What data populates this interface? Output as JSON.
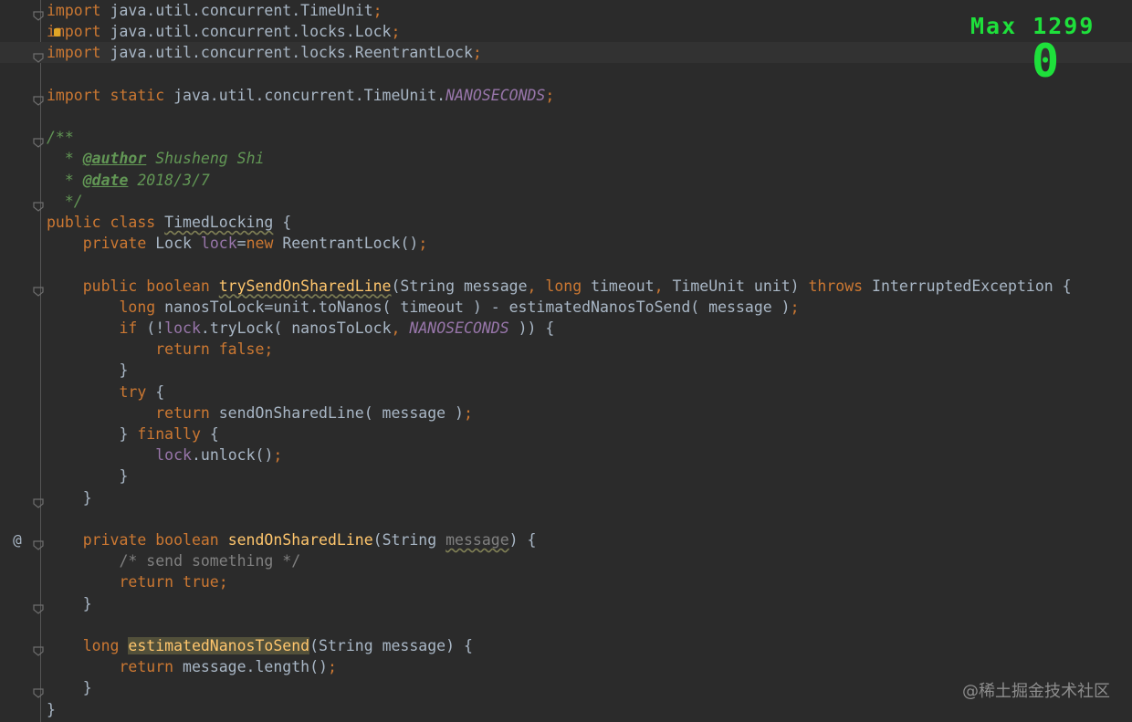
{
  "editor": {
    "lines": [
      {
        "segments": [
          {
            "t": "import",
            "c": "k"
          },
          {
            "t": " java.util.concurrent.TimeUnit",
            "c": "p"
          },
          {
            "t": ";",
            "c": "k"
          }
        ]
      },
      {
        "segments": [
          {
            "t": "import",
            "c": "k"
          },
          {
            "t": " java.util.concurrent.locks.Lock",
            "c": "p"
          },
          {
            "t": ";",
            "c": "k"
          }
        ]
      },
      {
        "segments": [
          {
            "t": "import",
            "c": "k"
          },
          {
            "t": " java.util.concurrent.locks.ReentrantLock",
            "c": "p"
          },
          {
            "t": ";",
            "c": "k"
          }
        ]
      },
      {
        "segments": []
      },
      {
        "segments": [
          {
            "t": "import static",
            "c": "k"
          },
          {
            "t": " java.util.concurrent.TimeUnit.",
            "c": "p"
          },
          {
            "t": "NANOSECONDS",
            "c": "fi"
          },
          {
            "t": ";",
            "c": "k"
          }
        ]
      },
      {
        "segments": []
      },
      {
        "segments": [
          {
            "t": "/**",
            "c": "d"
          }
        ]
      },
      {
        "segments": [
          {
            "t": "  * ",
            "c": "d"
          },
          {
            "t": "@author",
            "c": "dt"
          },
          {
            "t": " Shusheng Shi",
            "c": "d"
          }
        ]
      },
      {
        "segments": [
          {
            "t": "  * ",
            "c": "d"
          },
          {
            "t": "@date",
            "c": "dt"
          },
          {
            "t": " 2018/3/7",
            "c": "d"
          }
        ]
      },
      {
        "segments": [
          {
            "t": "  */",
            "c": "d"
          }
        ]
      },
      {
        "segments": [
          {
            "t": "public class ",
            "c": "k"
          },
          {
            "t": "TimedLocking",
            "c": "p warn"
          },
          {
            "t": " {",
            "c": "p"
          }
        ]
      },
      {
        "segments": [
          {
            "t": "    private ",
            "c": "k"
          },
          {
            "t": "Lock ",
            "c": "p"
          },
          {
            "t": "lock",
            "c": "f"
          },
          {
            "t": "=",
            "c": "p"
          },
          {
            "t": "new ",
            "c": "k"
          },
          {
            "t": "ReentrantLock()",
            "c": "p"
          },
          {
            "t": ";",
            "c": "k"
          }
        ]
      },
      {
        "segments": []
      },
      {
        "segments": [
          {
            "t": "    public boolean ",
            "c": "k"
          },
          {
            "t": "trySendOnSharedLine",
            "c": "m warn"
          },
          {
            "t": "(String message",
            "c": "p"
          },
          {
            "t": ", ",
            "c": "k"
          },
          {
            "t": "long ",
            "c": "k"
          },
          {
            "t": "timeout",
            "c": "p"
          },
          {
            "t": ", ",
            "c": "k"
          },
          {
            "t": "TimeUnit unit) ",
            "c": "p"
          },
          {
            "t": "throws ",
            "c": "k"
          },
          {
            "t": "InterruptedException {",
            "c": "p"
          }
        ]
      },
      {
        "segments": [
          {
            "t": "        long ",
            "c": "k"
          },
          {
            "t": "nanosToLock=unit.toNanos( timeout ) - estimatedNanosToSend( message )",
            "c": "p"
          },
          {
            "t": ";",
            "c": "k"
          }
        ]
      },
      {
        "segments": [
          {
            "t": "        if ",
            "c": "k"
          },
          {
            "t": "(!",
            "c": "p"
          },
          {
            "t": "lock",
            "c": "f"
          },
          {
            "t": ".tryLock( nanosToLock",
            "c": "p"
          },
          {
            "t": ", ",
            "c": "k"
          },
          {
            "t": "NANOSECONDS",
            "c": "fi"
          },
          {
            "t": " )) {",
            "c": "p"
          }
        ]
      },
      {
        "segments": [
          {
            "t": "            return false",
            "c": "k"
          },
          {
            "t": ";",
            "c": "k"
          }
        ]
      },
      {
        "segments": [
          {
            "t": "        }",
            "c": "p"
          }
        ]
      },
      {
        "segments": [
          {
            "t": "        try ",
            "c": "k"
          },
          {
            "t": "{",
            "c": "p"
          }
        ]
      },
      {
        "segments": [
          {
            "t": "            return ",
            "c": "k"
          },
          {
            "t": "sendOnSharedLine( message )",
            "c": "p"
          },
          {
            "t": ";",
            "c": "k"
          }
        ]
      },
      {
        "segments": [
          {
            "t": "        } ",
            "c": "p"
          },
          {
            "t": "finally ",
            "c": "k"
          },
          {
            "t": "{",
            "c": "p"
          }
        ]
      },
      {
        "segments": [
          {
            "t": "            ",
            "c": "p"
          },
          {
            "t": "lock",
            "c": "f"
          },
          {
            "t": ".unlock()",
            "c": "p"
          },
          {
            "t": ";",
            "c": "k"
          }
        ]
      },
      {
        "segments": [
          {
            "t": "        }",
            "c": "p"
          }
        ]
      },
      {
        "segments": [
          {
            "t": "    }",
            "c": "p"
          }
        ]
      },
      {
        "segments": []
      },
      {
        "segments": [
          {
            "t": "    private boolean ",
            "c": "k"
          },
          {
            "t": "sendOnSharedLine",
            "c": "m"
          },
          {
            "t": "(String ",
            "c": "p"
          },
          {
            "t": "message",
            "c": "c warn"
          },
          {
            "t": ") {",
            "c": "p"
          }
        ]
      },
      {
        "segments": [
          {
            "t": "        /* send something */",
            "c": "c"
          }
        ]
      },
      {
        "segments": [
          {
            "t": "        return true",
            "c": "k"
          },
          {
            "t": ";",
            "c": "k"
          }
        ]
      },
      {
        "segments": [
          {
            "t": "    }",
            "c": "p"
          }
        ]
      },
      {
        "segments": []
      },
      {
        "segments": [
          {
            "t": "    long ",
            "c": "k"
          },
          {
            "t": "estimatedNanosToSend",
            "c": "m hl"
          },
          {
            "t": "(String message) {",
            "c": "p"
          }
        ]
      },
      {
        "segments": [
          {
            "t": "        return ",
            "c": "k"
          },
          {
            "t": "message.length()",
            "c": "p"
          },
          {
            "t": ";",
            "c": "k"
          }
        ]
      },
      {
        "segments": [
          {
            "t": "    }",
            "c": "p"
          }
        ]
      },
      {
        "segments": [
          {
            "t": "}",
            "c": "p"
          }
        ]
      }
    ],
    "gutter_mark": "@",
    "current_line": 3
  },
  "hud": {
    "max_label": "Max 1299",
    "score": "0"
  },
  "watermark": "@稀土掘金技术社区",
  "colors": {
    "background": "#2b2b2b",
    "keyword": "#cc7832",
    "text": "#a9b7c6",
    "field": "#9876aa",
    "method": "#ffc66d",
    "doc": "#629755",
    "comment": "#808080",
    "hud": "#1ee03b"
  }
}
